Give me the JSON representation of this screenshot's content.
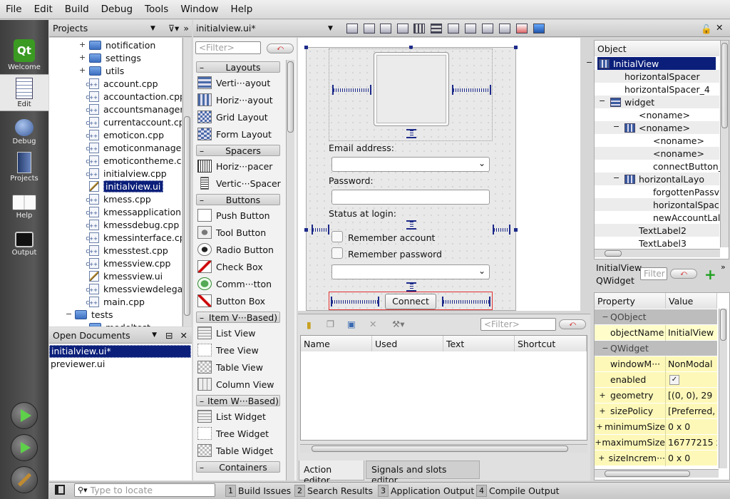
{
  "menu": [
    "File",
    "Edit",
    "Build",
    "Debug",
    "Tools",
    "Window",
    "Help"
  ],
  "modes": [
    {
      "label": "Welcome",
      "icon": "qt-logo-icon"
    },
    {
      "label": "Edit",
      "icon": "edit-document-icon"
    },
    {
      "label": "Debug",
      "icon": "bug-icon"
    },
    {
      "label": "Projects",
      "icon": "projects-book-icon"
    },
    {
      "label": "Help",
      "icon": "book-icon"
    },
    {
      "label": "Output",
      "icon": "monitor-icon"
    }
  ],
  "projects": {
    "header": "Projects",
    "items": [
      {
        "label": "notification",
        "type": "folder",
        "expandable": true
      },
      {
        "label": "settings",
        "type": "folder",
        "expandable": true
      },
      {
        "label": "utils",
        "type": "folder",
        "expandable": true
      },
      {
        "label": "account.cpp",
        "type": "cpp"
      },
      {
        "label": "accountaction.cpp",
        "type": "cpp"
      },
      {
        "label": "accountsmanager.",
        "type": "cpp"
      },
      {
        "label": "currentaccount.cp",
        "type": "cpp"
      },
      {
        "label": "emoticon.cpp",
        "type": "cpp"
      },
      {
        "label": "emoticonmanager.",
        "type": "cpp"
      },
      {
        "label": "emoticontheme.cp",
        "type": "cpp"
      },
      {
        "label": "initialview.cpp",
        "type": "cpp"
      },
      {
        "label": "initialview.ui",
        "type": "ui",
        "selected": true
      },
      {
        "label": "kmess.cpp",
        "type": "cpp"
      },
      {
        "label": "kmessapplication.c",
        "type": "cpp"
      },
      {
        "label": "kmessdebug.cpp",
        "type": "cpp"
      },
      {
        "label": "kmessinterface.cp",
        "type": "cpp"
      },
      {
        "label": "kmesstest.cpp",
        "type": "cpp"
      },
      {
        "label": "kmessview.cpp",
        "type": "cpp"
      },
      {
        "label": "kmessview.ui",
        "type": "ui"
      },
      {
        "label": "kmessviewdelegat",
        "type": "cpp"
      },
      {
        "label": "main.cpp",
        "type": "cpp"
      },
      {
        "label": "tests",
        "type": "folder",
        "expanded": true
      },
      {
        "label": "modeltest",
        "type": "folder"
      }
    ]
  },
  "open_documents": {
    "header": "Open Documents",
    "items": [
      "initialview.ui*",
      "previewer.ui"
    ]
  },
  "editor": {
    "file": "initialview.ui*",
    "widget_box": {
      "filter_placeholder": "<Filter>",
      "categories": {
        "layouts": "Layouts",
        "spacers": "Spacers",
        "buttons": "Buttons",
        "item_views": "Item V···Based)",
        "item_widgets": "Item W···Based)",
        "containers": "Containers"
      },
      "layouts": [
        "Verti···ayout",
        "Horiz···ayout",
        "Grid Layout",
        "Form Layout"
      ],
      "spacers": [
        "Horiz···pacer",
        "Vertic···Spacer"
      ],
      "buttons": [
        "Push Button",
        "Tool Button",
        "Radio Button",
        "Check Box",
        "Comm···tton",
        "Button Box"
      ],
      "item_views": [
        "List View",
        "Tree View",
        "Table View",
        "Column View"
      ],
      "item_widgets": [
        "List Widget",
        "Tree Widget",
        "Table Widget"
      ]
    },
    "form": {
      "email_label": "Email address:",
      "password_label": "Password:",
      "status_label": "Status at login:",
      "remember_account": "Remember account",
      "remember_password": "Remember password",
      "connect": "Connect"
    },
    "action_editor": {
      "filter_placeholder": "<Filter>",
      "columns": [
        "Name",
        "Used",
        "Text",
        "Shortcut"
      ],
      "tabs": [
        "Action editor",
        "Signals and slots editor"
      ]
    }
  },
  "object_inspector": {
    "header": "Object",
    "items": [
      {
        "label": "InitialView",
        "depth": 0,
        "selected": true
      },
      {
        "label": "horizontalSpacer",
        "depth": 1
      },
      {
        "label": "horizontalSpacer_4",
        "depth": 1
      },
      {
        "label": "widget",
        "depth": 1
      },
      {
        "label": "<noname>",
        "depth": 2
      },
      {
        "label": "<noname>",
        "depth": 2
      },
      {
        "label": "<noname>",
        "depth": 3
      },
      {
        "label": "<noname>",
        "depth": 3
      },
      {
        "label": "connectButton_",
        "depth": 3
      },
      {
        "label": "horizontalLayo",
        "depth": 2
      },
      {
        "label": "forgottenPassv",
        "depth": 3
      },
      {
        "label": "horizontalSpac",
        "depth": 3
      },
      {
        "label": "newAccountLal",
        "depth": 3
      },
      {
        "label": "TextLabel2",
        "depth": 2
      },
      {
        "label": "TextLabel3",
        "depth": 2
      }
    ]
  },
  "property_editor": {
    "title_line1": "InitialView",
    "title_line2": "QWidget",
    "filter_placeholder": "Filter",
    "col_property": "Property",
    "col_value": "Value",
    "rows": [
      {
        "name": "QObject",
        "value": "",
        "kind": "cat"
      },
      {
        "name": "objectName",
        "value": "InitialView",
        "kind": "val"
      },
      {
        "name": "QWidget",
        "value": "",
        "kind": "cat"
      },
      {
        "name": "windowM···",
        "value": "NonModal",
        "kind": "val2"
      },
      {
        "name": "enabled",
        "value": "✓",
        "kind": "val2"
      },
      {
        "name": "geometry",
        "value": "[(0, 0), 29",
        "kind": "val2",
        "expand": true
      },
      {
        "name": "sizePolicy",
        "value": "[Preferred,",
        "kind": "val2",
        "expand": true
      },
      {
        "name": "minimumSize",
        "value": "0 x 0",
        "kind": "val2",
        "expand": true
      },
      {
        "name": "maximumSize",
        "value": "16777215 x",
        "kind": "val2",
        "expand": true
      },
      {
        "name": "sizeIncrem···",
        "value": "0 x 0",
        "kind": "val2",
        "expand": true
      }
    ]
  },
  "statusbar": {
    "locate_placeholder": "Type to locate",
    "panes": [
      {
        "n": "1",
        "label": "Build Issues"
      },
      {
        "n": "2",
        "label": "Search Results"
      },
      {
        "n": "3",
        "label": "Application Output"
      },
      {
        "n": "4",
        "label": "Compile Output"
      }
    ]
  }
}
